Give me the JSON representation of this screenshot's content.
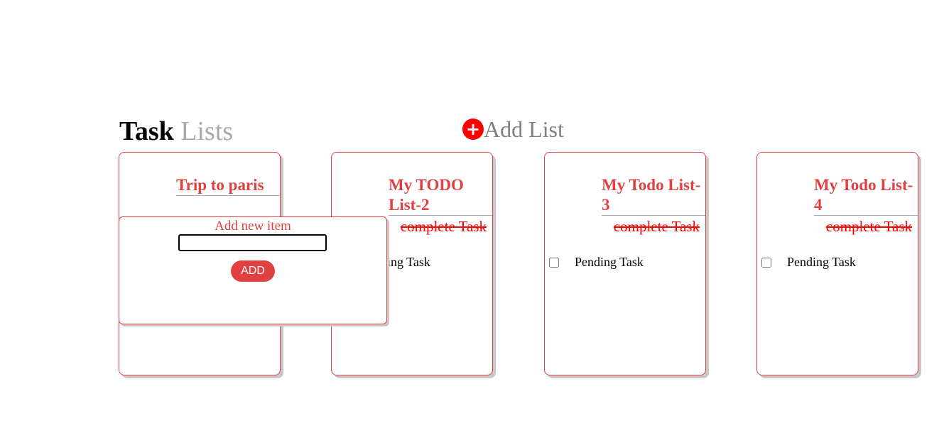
{
  "header": {
    "title_bold": "Task",
    "title_light": "Lists",
    "add_list_label": "Add List",
    "add_icon": "+"
  },
  "lists": [
    {
      "title": "Trip to paris"
    },
    {
      "title": "My TODO List-2",
      "completed": "complete Task",
      "pending": "Pending Task"
    },
    {
      "title": "My Todo List-3",
      "completed": "complete Task",
      "pending": "Pending Task"
    },
    {
      "title": "My Todo List-4",
      "completed": "complete Task",
      "pending": "Pending Task"
    }
  ],
  "popup": {
    "label": "Add new item",
    "input_value": "",
    "button": "ADD"
  },
  "colors": {
    "accent": "#e04040",
    "add_icon": "#ff0000"
  }
}
